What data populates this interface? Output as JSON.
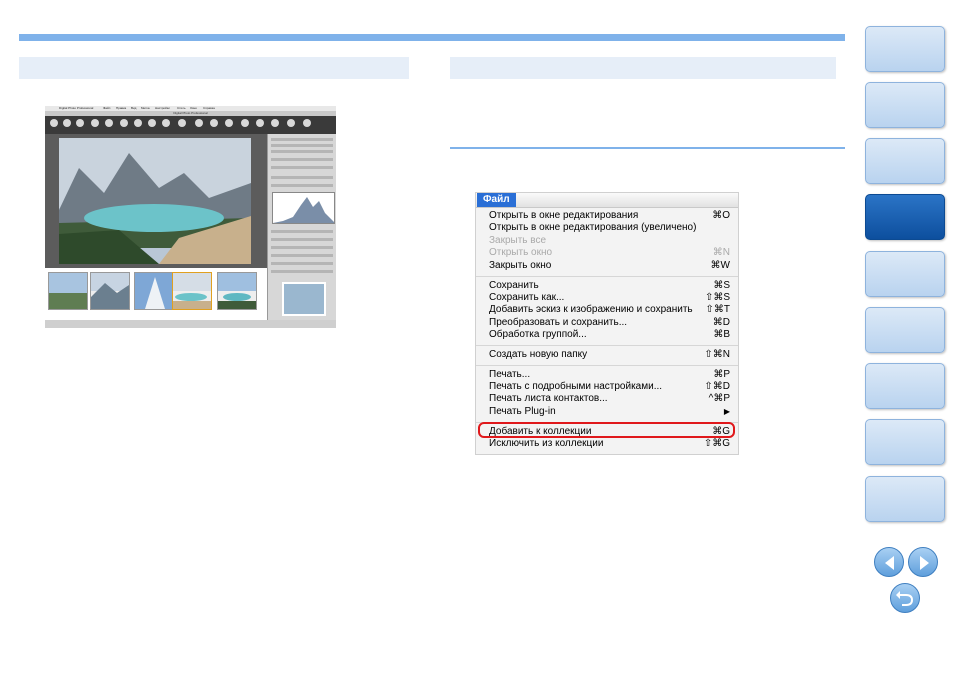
{
  "screenshot_app": {
    "menubar": [
      "Digital Photo Professional",
      "Файл",
      "Правка",
      "Вид",
      "Метка",
      "Настройки",
      "Стиль",
      "Окно",
      "Справка"
    ],
    "titlebar": "Digital Photo Professional"
  },
  "file_menu": {
    "title": "Файл",
    "groups": [
      [
        {
          "label": "Открыть в окне редактирования",
          "shortcut": "⌘O",
          "enabled": true
        },
        {
          "label": "Открыть в окне редактирования (увеличено)",
          "shortcut": "",
          "enabled": true
        },
        {
          "label": "Закрыть все",
          "shortcut": "",
          "enabled": false
        },
        {
          "label": "Открыть окно",
          "shortcut": "⌘N",
          "enabled": false
        },
        {
          "label": "Закрыть окно",
          "shortcut": "⌘W",
          "enabled": true
        }
      ],
      [
        {
          "label": "Сохранить",
          "shortcut": "⌘S",
          "enabled": true
        },
        {
          "label": "Сохранить как...",
          "shortcut": "⇧⌘S",
          "enabled": true
        },
        {
          "label": "Добавить эскиз к изображению и сохранить",
          "shortcut": "⇧⌘T",
          "enabled": true
        },
        {
          "label": "Преобразовать и сохранить...",
          "shortcut": "⌘D",
          "enabled": true
        },
        {
          "label": "Обработка группой...",
          "shortcut": "⌘B",
          "enabled": true
        }
      ],
      [
        {
          "label": "Создать новую папку",
          "shortcut": "⇧⌘N",
          "enabled": true
        }
      ],
      [
        {
          "label": "Печать...",
          "shortcut": "⌘P",
          "enabled": true
        },
        {
          "label": "Печать с подробными настройками...",
          "shortcut": "⇧⌘D",
          "enabled": true
        },
        {
          "label": "Печать листа контактов...",
          "shortcut": "^⌘P",
          "enabled": true
        },
        {
          "label": "Печать Plug-in",
          "shortcut": "▶",
          "enabled": true
        }
      ],
      [
        {
          "label": "Добавить к коллекции",
          "shortcut": "⌘G",
          "enabled": true,
          "highlighted": true
        },
        {
          "label": "Исключить из коллекции",
          "shortcut": "⇧⌘G",
          "enabled": true
        }
      ]
    ]
  },
  "nav": {
    "tabs": [
      {
        "active": false
      },
      {
        "active": false
      },
      {
        "active": false
      },
      {
        "active": true
      },
      {
        "active": false
      },
      {
        "active": false
      },
      {
        "active": false
      },
      {
        "active": false
      },
      {
        "active": false
      }
    ],
    "buttons": [
      "prev-page-icon",
      "next-page-icon",
      "return-icon"
    ]
  },
  "colors": {
    "accent_bar": "#7fb2ea",
    "section_head": "#e6eef8",
    "active_tab": "#0d4f9e",
    "menu_highlight": "#2a6fd6",
    "callout": "#e0181b"
  }
}
